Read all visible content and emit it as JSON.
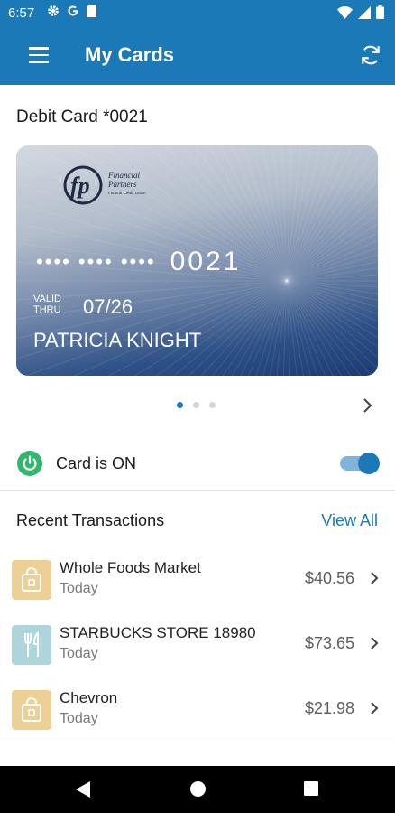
{
  "status_bar": {
    "time": "6:57",
    "icons_left": [
      "gear-icon",
      "google-icon",
      "sd-card-icon"
    ],
    "icons_right": [
      "wifi-icon",
      "signal-icon",
      "battery-icon"
    ]
  },
  "app_bar": {
    "title": "My Cards",
    "menu_icon": "hamburger-menu-icon",
    "refresh_icon": "refresh-icon",
    "color": "#1b79b8"
  },
  "card": {
    "header": "Debit Card *0021",
    "masked": "•••• •••• ••••",
    "last4": "0021",
    "valid_thru": "VALID THRU",
    "expiry": "07/26",
    "holder": "PATRICIA KNIGHT",
    "logo_lines": [
      "Financial",
      "Partners",
      "Federal Credit Union"
    ]
  },
  "pager": {
    "count": 3,
    "active": 1
  },
  "card_status": {
    "label": "Card is ON",
    "on": true,
    "power_color": "#2fb86b"
  },
  "transactions": {
    "title": "Recent Transactions",
    "view_all": "View All",
    "items": [
      {
        "merchant": "Whole Foods Market",
        "date": "Today",
        "amount": "$40.56",
        "icon": "shopping-bag-icon"
      },
      {
        "merchant": "STARBUCKS STORE 18980",
        "date": "Today",
        "amount": "$73.65",
        "icon": "fork-knife-icon"
      },
      {
        "merchant": "Chevron",
        "date": "Today",
        "amount": "$21.98",
        "icon": "shopping-bag-icon"
      }
    ]
  }
}
